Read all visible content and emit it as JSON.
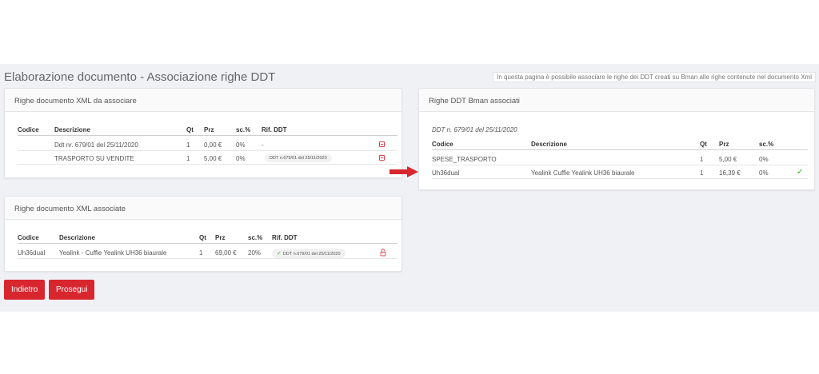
{
  "page": {
    "title": "Elaborazione documento - Associazione righe DDT",
    "info": "In questa pagina è possibile associare le righe dei DDT creati su Bman alle righe contenute nel documento Xml"
  },
  "panel_to_associate": {
    "title": "Righe documento XML da associare",
    "columns": {
      "codice": "Codice",
      "descrizione": "Descrizione",
      "qt": "Qt",
      "prz": "Prz",
      "sc": "sc.%",
      "rif": "Rif. DDT"
    },
    "rows": [
      {
        "codice": "",
        "descrizione": "Ddt nr. 679/01 del 25/11/2020",
        "qt": "1",
        "prz": "0,00 €",
        "sc": "0%",
        "rif": "-"
      },
      {
        "codice": "",
        "descrizione": "TRASPORTO SU VENDITE",
        "qt": "1",
        "prz": "5,00 €",
        "sc": "0%",
        "rif": "DDT n.679/01 del 25/11/2020"
      }
    ]
  },
  "panel_associated": {
    "title": "Righe documento XML associate",
    "columns": {
      "codice": "Codice",
      "descrizione": "Descrizione",
      "qt": "Qt",
      "prz": "Prz",
      "sc": "sc.%",
      "rif": "Rif. DDT"
    },
    "rows": [
      {
        "codice": "Uh36dual",
        "descrizione": "Yealink - Cuffie Yealink UH36 biaurale",
        "qt": "1",
        "prz": "69,00 €",
        "sc": "20%",
        "rif": "DDT n.679/01 del 25/11/2020"
      }
    ]
  },
  "panel_ddt": {
    "title": "Righe DDT Bman associati",
    "subtitle": "DDT n. 679/01 del 25/11/2020",
    "columns": {
      "codice": "Codice",
      "descrizione": "Descrizione",
      "qt": "Qt",
      "prz": "Prz",
      "sc": "sc.%"
    },
    "rows": [
      {
        "codice": "SPESE_TRASPORTO",
        "descrizione": "",
        "qt": "1",
        "prz": "5,00 €",
        "sc": "0%"
      },
      {
        "codice": "Uh36dual",
        "descrizione": "Yealink Cuffie Yealink UH36 biaurale",
        "qt": "1",
        "prz": "16,39 €",
        "sc": "0%"
      }
    ]
  },
  "buttons": {
    "back": "Indietro",
    "next": "Prosegui"
  },
  "colors": {
    "accent": "#d8262f",
    "success": "#3fae2a",
    "background": "#f0f1f5"
  }
}
